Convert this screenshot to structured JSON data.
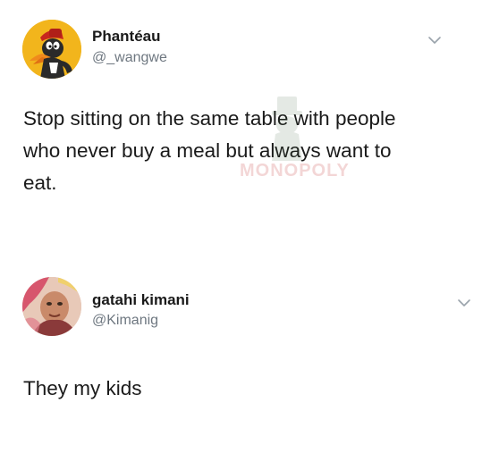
{
  "tweets": [
    {
      "display_name": "Phantéau",
      "handle": "@_wangwe",
      "text_lines": [
        "Stop sitting on the same table with people",
        "who never buy a meal but always want to",
        "eat."
      ],
      "avatar_icon": "cartoon-duck-avatar",
      "menu_icon": "chevron-down-icon"
    },
    {
      "display_name": "gatahi kimani",
      "handle": "@Kimanig",
      "text_lines": [
        "They my kids"
      ],
      "avatar_icon": "profile-photo-avatar",
      "menu_icon": "chevron-down-icon"
    }
  ],
  "watermark": {
    "text": "MONOPOLY"
  },
  "colors": {
    "background": "#ffffff",
    "text": "#1a1a1a",
    "handle": "#6e7780",
    "chevron": "#9aa3ab",
    "avatar1_bg": "#f2b51c"
  }
}
